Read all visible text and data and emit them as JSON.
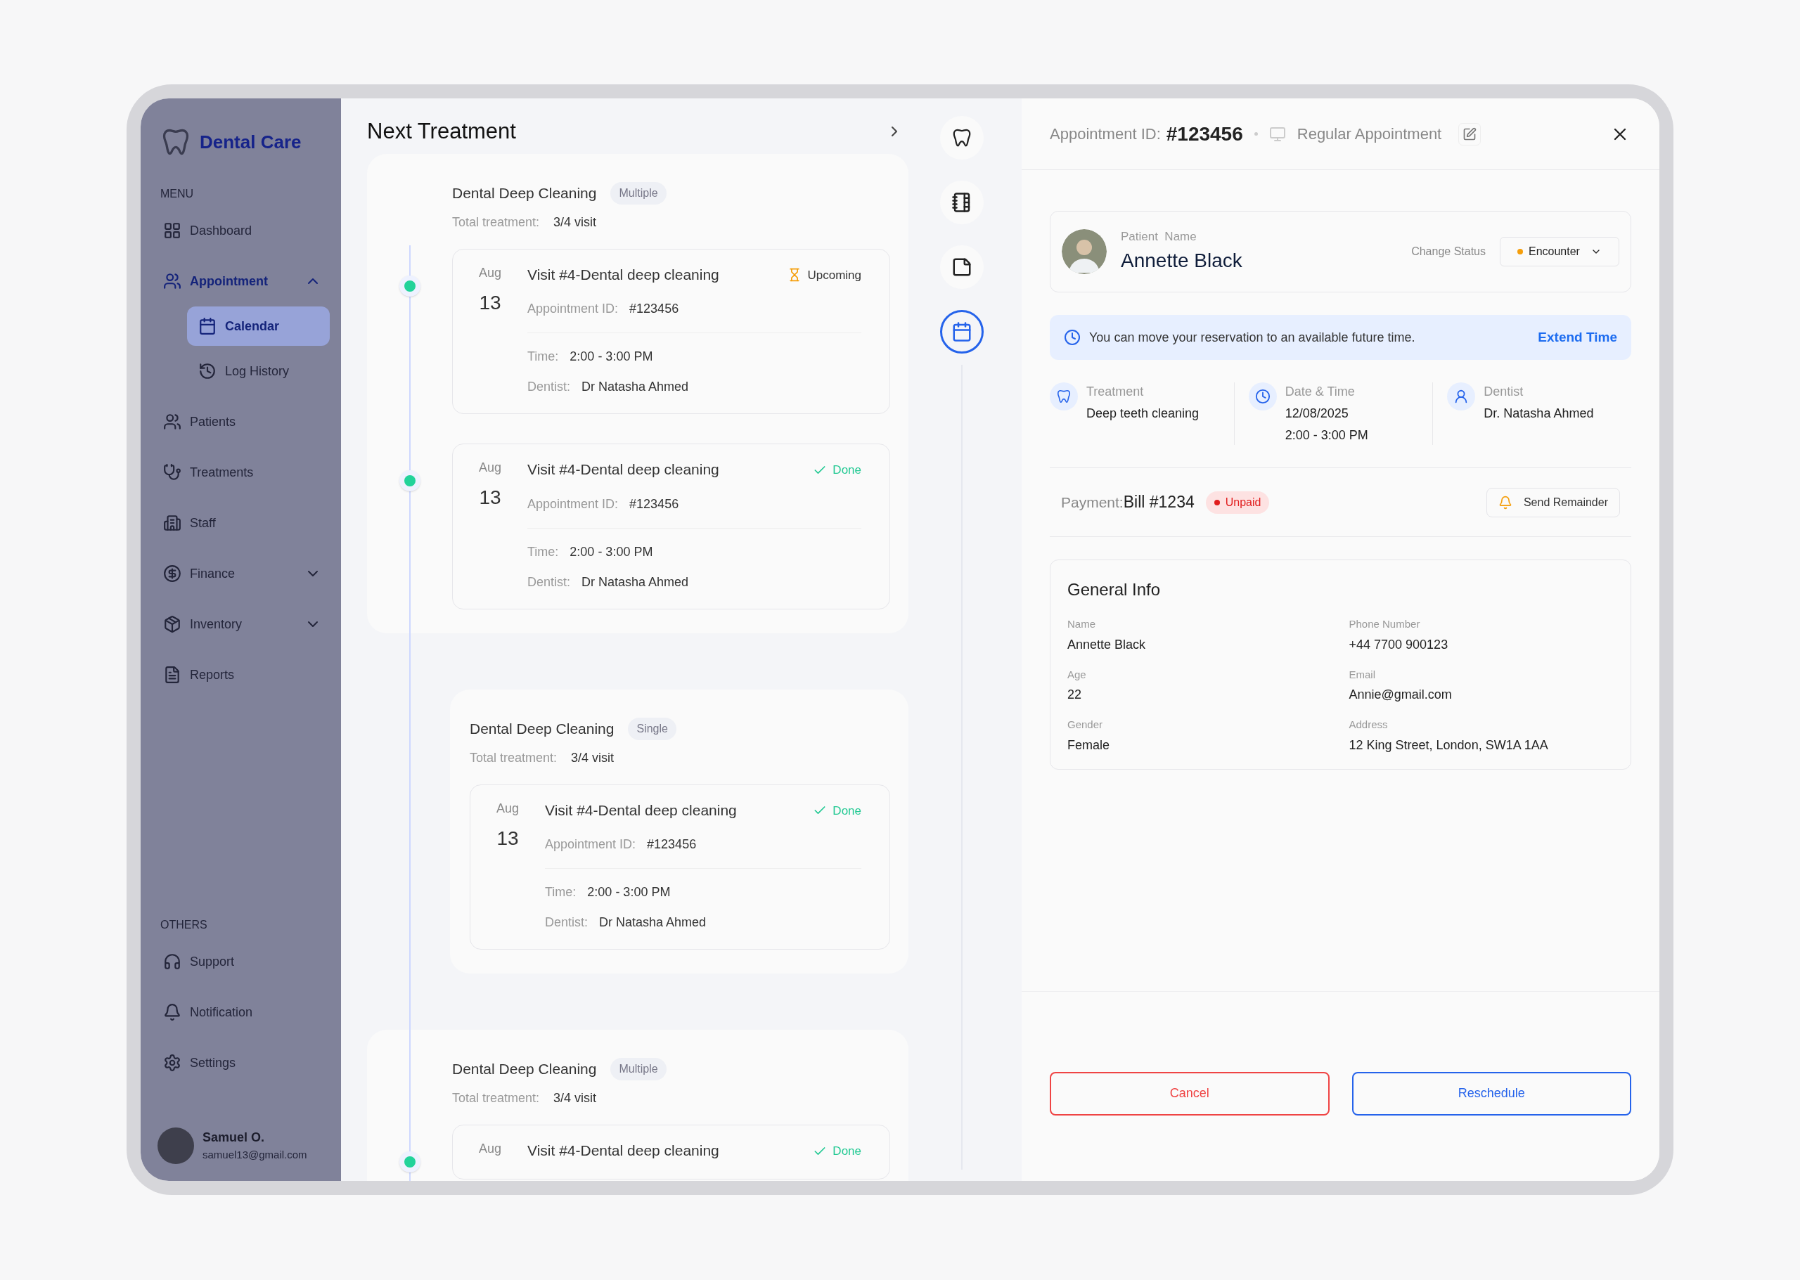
{
  "sidebar": {
    "brand": "Dental Care",
    "sections": [
      {
        "heading": "MENU",
        "items": [
          {
            "label": "Dashboard",
            "selected": false
          },
          {
            "label": "Appointment",
            "selected": true,
            "expanded": true,
            "children": [
              {
                "label": "Calendar",
                "selected": true
              },
              {
                "label": "Log History",
                "selected": false
              }
            ]
          },
          {
            "label": "Patients",
            "selected": false
          },
          {
            "label": "Treatments",
            "selected": false
          },
          {
            "label": "Staff",
            "selected": false
          },
          {
            "label": "Finance",
            "selected": false,
            "expanded": false
          },
          {
            "label": "Inventory",
            "selected": false,
            "expanded": false
          },
          {
            "label": "Reports",
            "selected": false
          }
        ]
      },
      {
        "heading": "OTHERS",
        "items": [
          {
            "label": "Support",
            "selected": false
          },
          {
            "label": "Notification",
            "selected": false
          },
          {
            "label": "Settings",
            "selected": false
          }
        ]
      }
    ],
    "user": {
      "name": "Samuel O.",
      "email": "samuel13@gmail.com"
    }
  },
  "treatments": {
    "title": "Next Treatment",
    "groups": [
      {
        "nested": false,
        "name": "Dental Deep Cleaning",
        "tag": "Multiple",
        "total_label": "Total treatment:",
        "total": "3/4 visit",
        "visits": [
          {
            "month": "Aug",
            "day": "13",
            "title": "Visit #4-Dental deep cleaning",
            "kind": "upcoming",
            "status_label": "Upcoming",
            "id_label": "Appointment ID:",
            "id": "#123456",
            "time_label": "Time:",
            "time": "2:00 - 3:00 PM",
            "dentist_label": "Dentist:",
            "dentist": "Dr Natasha Ahmed"
          },
          {
            "month": "Aug",
            "day": "13",
            "title": "Visit #4-Dental deep cleaning",
            "kind": "done",
            "status_label": "Done",
            "id_label": "Appointment ID:",
            "id": "#123456",
            "time_label": "Time:",
            "time": "2:00 - 3:00 PM",
            "dentist_label": "Dentist:",
            "dentist": "Dr Natasha Ahmed"
          }
        ]
      },
      {
        "nested": true,
        "name": "Dental Deep Cleaning",
        "tag": "Single",
        "total_label": "Total treatment:",
        "total": "3/4 visit",
        "visits": [
          {
            "month": "Aug",
            "day": "13",
            "title": "Visit #4-Dental deep cleaning",
            "kind": "done",
            "status_label": "Done",
            "id_label": "Appointment ID:",
            "id": "#123456",
            "time_label": "Time:",
            "time": "2:00 - 3:00 PM",
            "dentist_label": "Dentist:",
            "dentist": "Dr Natasha Ahmed"
          }
        ]
      },
      {
        "nested": false,
        "name": "Dental Deep Cleaning",
        "tag": "Multiple",
        "total_label": "Total treatment:",
        "total": "3/4 visit",
        "visits": [
          {
            "month": "Aug",
            "title": "Visit #4-Dental deep cleaning",
            "kind": "done",
            "status_label": "Done"
          }
        ]
      }
    ]
  },
  "tools": [
    {
      "selected": false
    },
    {
      "selected": false
    },
    {
      "selected": false
    },
    {
      "selected": true
    }
  ],
  "appointment": {
    "id_label": "Appointment ID:",
    "id": "#123456",
    "type": "Regular Appointment",
    "patient": {
      "label": "Patient  Name",
      "name": "Annette Black"
    },
    "status": {
      "label": "Change Status",
      "value": "Encounter",
      "color": "#f59e0b"
    },
    "notice": {
      "text": "You can move your reservation to an available future time.",
      "action": "Extend Time"
    },
    "details": [
      {
        "label": "Treatment",
        "lines": [
          "Deep teeth cleaning"
        ]
      },
      {
        "label": "Date & Time",
        "lines": [
          "12/08/2025",
          "2:00 - 3:00 PM"
        ]
      },
      {
        "label": "Dentist",
        "lines": [
          "Dr. Natasha Ahmed"
        ]
      }
    ],
    "payment": {
      "label": "Payment:",
      "bill": "Bill #1234",
      "badge": "Unpaid",
      "paid": false,
      "remind": "Send Remainder"
    },
    "general": {
      "title": "General Info",
      "fields": [
        {
          "label": "Name",
          "value": "Annette Black"
        },
        {
          "label": "Phone Number",
          "value": "+44 7700 900123"
        },
        {
          "label": "Age",
          "value": "22"
        },
        {
          "label": "Email",
          "value": "Annie@gmail.com"
        },
        {
          "label": "Gender",
          "value": "Female"
        },
        {
          "label": "Address",
          "value": "12 King Street, London, SW1A 1AA"
        }
      ]
    },
    "buttons": [
      {
        "kind": "cancel",
        "label": "Cancel"
      },
      {
        "kind": "primary",
        "label": "Reschedule"
      }
    ]
  }
}
